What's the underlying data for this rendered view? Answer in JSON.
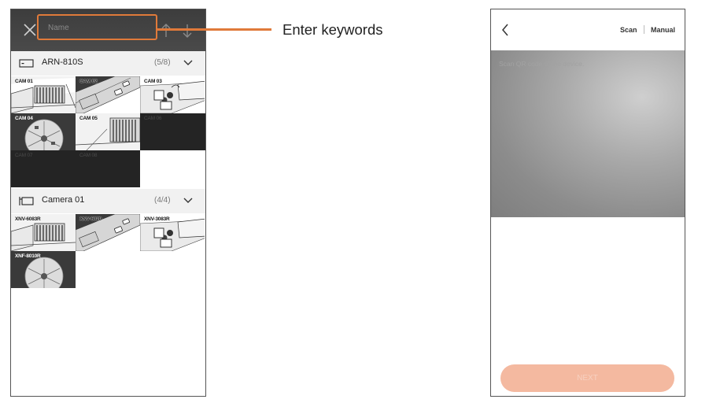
{
  "search": {
    "placeholder": "Name"
  },
  "groups": [
    {
      "name": "ARN-810S",
      "count": "(5/8)",
      "cameras": [
        "CAM 01",
        "CAM 02",
        "CAM 03",
        "CAM 04",
        "CAM 05",
        "CAM 06",
        "CAM 07",
        "CAM 08"
      ]
    },
    {
      "name": "Camera 01",
      "count": "(4/4)",
      "cameras": [
        "XNV-6083R",
        "XNV-6020",
        "XNV-3083R",
        "XNF-8010R"
      ]
    }
  ],
  "callout": {
    "text": "Enter keywords"
  },
  "register": {
    "tab_scan": "Scan",
    "tab_manual": "Manual",
    "instruction": "Scan QR code of the device.",
    "next_label": "NEXT"
  },
  "colors": {
    "accent": "#e07a3a",
    "header_bg": "#444444",
    "next_button": "#f4b9a0"
  }
}
